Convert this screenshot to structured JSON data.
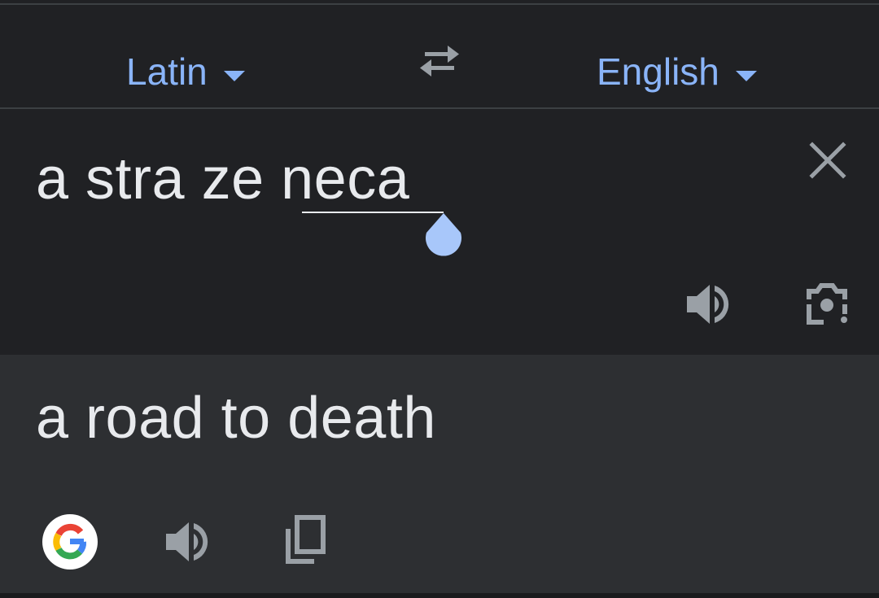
{
  "languages": {
    "source": "Latin",
    "target": "English"
  },
  "source": {
    "text_before": "a stra ze ",
    "text_selected": "neca"
  },
  "result": {
    "text": "a road to death"
  },
  "icons": {
    "swap": "swap-arrows-icon",
    "clear": "close-icon",
    "source_speaker": "speaker-icon",
    "camera": "camera-icon",
    "google": "google-logo-icon",
    "result_speaker": "speaker-icon",
    "copy": "copy-icon"
  },
  "colors": {
    "accent": "#8ab4f8",
    "text": "#e8eaed",
    "icon": "#9aa0a6",
    "background": "#202124",
    "result_background": "#2d2f32"
  }
}
